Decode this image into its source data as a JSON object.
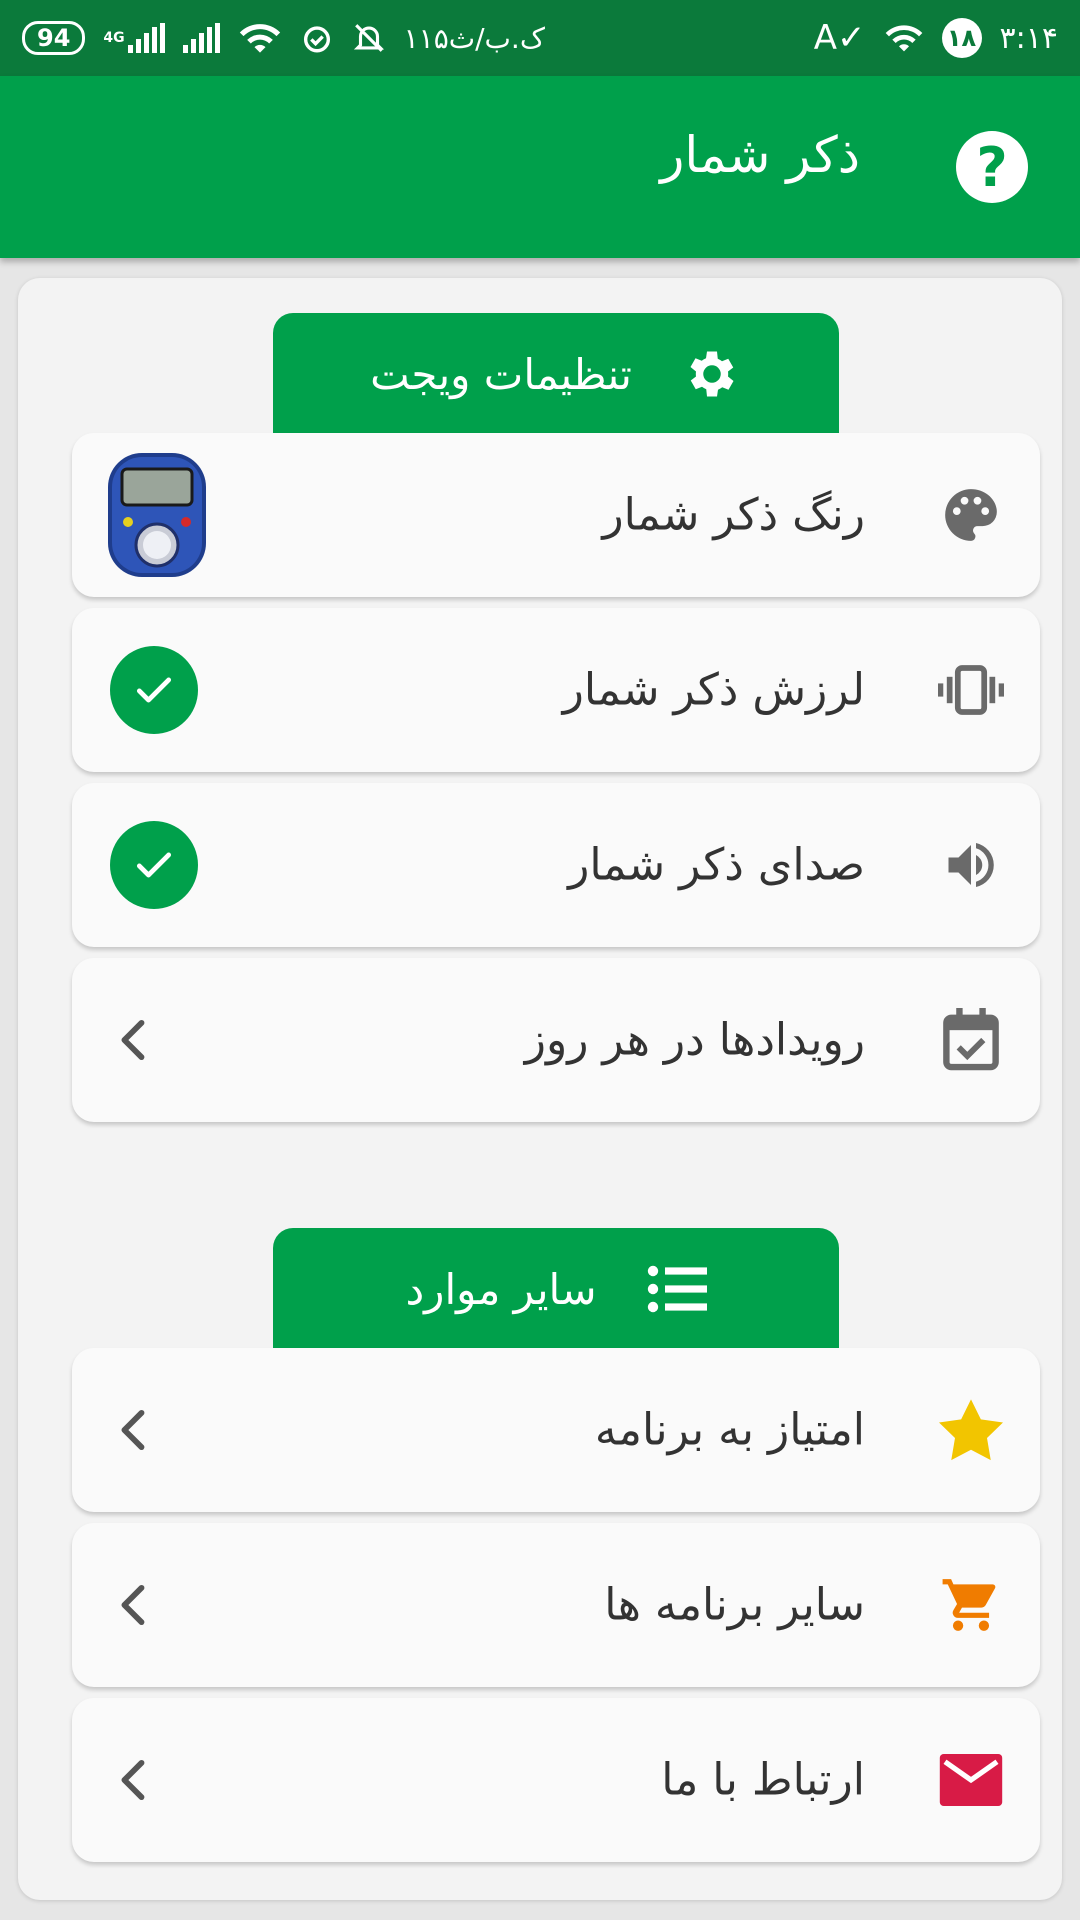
{
  "status_bar": {
    "time": "۳:۱۴",
    "badge": "۱۸",
    "carrier": "۱۱۵ک.ب/ث",
    "battery": "94",
    "network": "4G"
  },
  "app_bar": {
    "title": "ذکر شمار",
    "help": "?"
  },
  "sections": {
    "widget_settings": {
      "title": "تنظیمات ویجت",
      "items": [
        {
          "label": "رنگ ذکر شمار"
        },
        {
          "label": "لرزش ذکر شمار",
          "checked": true
        },
        {
          "label": "صدای ذکر شمار",
          "checked": true
        },
        {
          "label": "رویدادها در هر روز"
        }
      ]
    },
    "other": {
      "title": "سایر موارد",
      "items": [
        {
          "label": "امتیاز به برنامه"
        },
        {
          "label": "سایر برنامه ها"
        },
        {
          "label": "ارتباط با ما"
        }
      ]
    }
  },
  "colors": {
    "primary": "#00a04b",
    "status_bar": "#0b7a3b",
    "star": "#f2c500",
    "cart": "#f07c00",
    "mail": "#d81b46",
    "icon_gray": "#6a6a6a"
  },
  "icons": {
    "help": "help-circle-icon",
    "settings": "gear-icon",
    "palette": "palette-icon",
    "vibrate": "vibrate-icon",
    "volume": "volume-icon",
    "calendar": "calendar-check-icon",
    "list": "list-icon",
    "star": "star-icon",
    "cart": "cart-icon",
    "mail": "mail-icon",
    "chevron": "chevron-left-icon",
    "check": "check-icon"
  }
}
